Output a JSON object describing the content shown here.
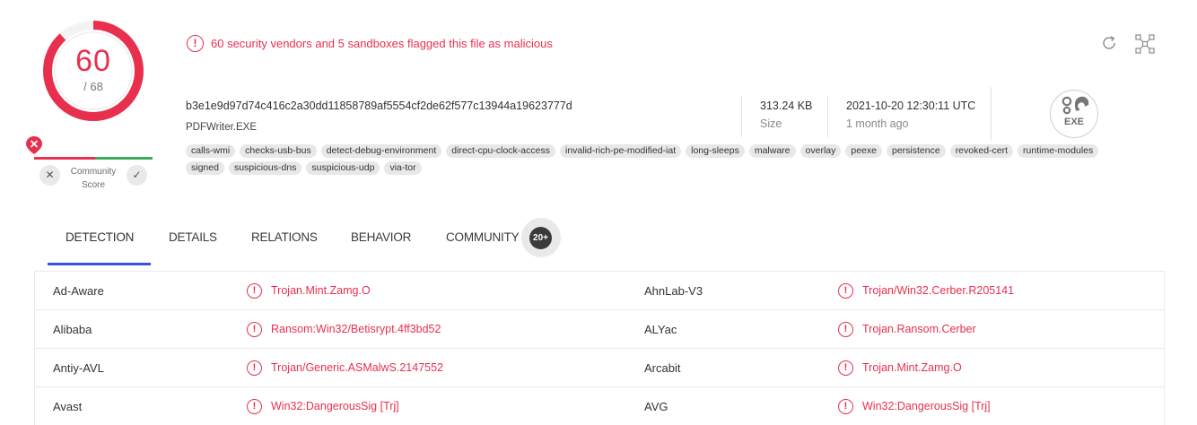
{
  "score": {
    "detections": "60",
    "total": "/ 68",
    "fraction": 0.882
  },
  "community": {
    "label": "Community Score",
    "down_icon": "x-icon",
    "up_icon": "check-icon"
  },
  "alert": {
    "text": "60 security vendors and 5 sandboxes flagged this file as malicious",
    "icon": "exclamation-circle-icon"
  },
  "file": {
    "hash": "b3e1e9d97d74c416c2a30dd11858789af5554cf2de62f577c13944a19623777d",
    "name": "PDFWriter.EXE",
    "size_value": "313.24 KB",
    "size_label": "Size",
    "date_value": "2021-10-20 12:30:11 UTC",
    "date_label": "1 month ago",
    "type_badge": "EXE"
  },
  "tags": [
    "calls-wmi",
    "checks-usb-bus",
    "detect-debug-environment",
    "direct-cpu-clock-access",
    "invalid-rich-pe-modified-iat",
    "long-sleeps",
    "malware",
    "overlay",
    "peexe",
    "persistence",
    "revoked-cert",
    "runtime-modules",
    "signed",
    "suspicious-dns",
    "suspicious-udp",
    "via-tor"
  ],
  "tabs": {
    "detection": "DETECTION",
    "details": "DETAILS",
    "relations": "RELATIONS",
    "behavior": "BEHAVIOR",
    "community": "COMMUNITY",
    "community_count": "20+"
  },
  "detections": [
    {
      "vendor": "Ad-Aware",
      "result": "Trojan.Mint.Zamg.O",
      "vendor2": "AhnLab-V3",
      "result2": "Trojan/Win32.Cerber.R205141"
    },
    {
      "vendor": "Alibaba",
      "result": "Ransom:Win32/Betisrypt.4ff3bd52",
      "vendor2": "ALYac",
      "result2": "Trojan.Ransom.Cerber"
    },
    {
      "vendor": "Antiy-AVL",
      "result": "Trojan/Generic.ASMalwS.2147552",
      "vendor2": "Arcabit",
      "result2": "Trojan.Mint.Zamg.O"
    },
    {
      "vendor": "Avast",
      "result": "Win32:DangerousSig [Trj]",
      "vendor2": "AVG",
      "result2": "Win32:DangerousSig [Trj]"
    }
  ],
  "colors": {
    "malicious": "#e8304e",
    "accent": "#3953e0",
    "harmless": "#3bab5d"
  }
}
